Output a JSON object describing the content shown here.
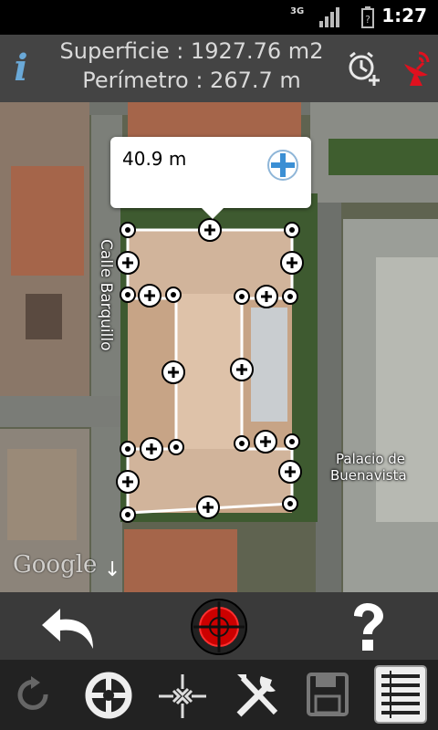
{
  "status": {
    "network": "3G",
    "time": "1:27"
  },
  "header": {
    "surface_text": "Superficie : 1927.76 m2",
    "perimeter_text": "Perímetro : 267.7 m"
  },
  "map": {
    "street_label": "Calle Barquillo",
    "place_label_line1": "Palacio de",
    "place_label_line2": "Buenavista",
    "attribution": "Google"
  },
  "bubble": {
    "segment_length": "40.9 m"
  },
  "colors": {
    "accent_red": "#e0101e",
    "bar_dark": "#444444",
    "info_blue": "#6aa9d8"
  },
  "icons": [
    "info-icon",
    "alarm-add-icon",
    "satellite-icon",
    "undo-icon",
    "crosshair-target-icon",
    "help-icon",
    "refresh-icon",
    "gps-locate-icon",
    "center-crosshair-icon",
    "tools-icon",
    "save-icon",
    "list-icon"
  ]
}
